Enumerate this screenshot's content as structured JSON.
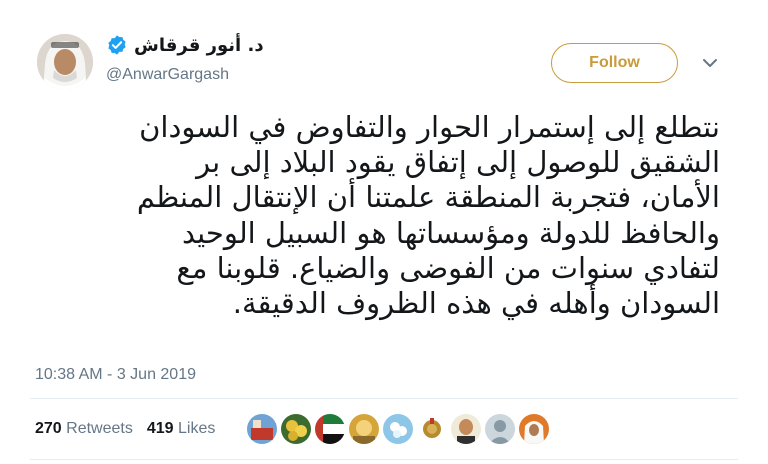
{
  "tweet": {
    "display_name": "د. أنور قرقاش",
    "handle": "@AnwarGargash",
    "follow_label": "Follow",
    "text_lines": [
      "نتطلع إلى إستمرار الحوار والتفاوض في السودان",
      "الشقيق للوصول إلى إتفاق يقود البلاد إلى بر",
      "الأمان، فتجربة المنطقة علمتنا أن الإنتقال المنظم",
      "والحافظ للدولة ومؤسساتها هو السبيل الوحيد",
      "لتفادي سنوات من الفوضى والضياع. قلوبنا مع",
      "السودان وأهله في هذه الظروف الدقيقة."
    ],
    "timestamp": "10:38 AM - 3 Jun 2019",
    "retweets_count": "270",
    "retweets_label": "Retweets",
    "likes_count": "419",
    "likes_label": "Likes"
  },
  "colors": {
    "accent": "#c99b3a",
    "verified": "#1da1f2",
    "muted": "#657786",
    "text": "#14171a"
  }
}
